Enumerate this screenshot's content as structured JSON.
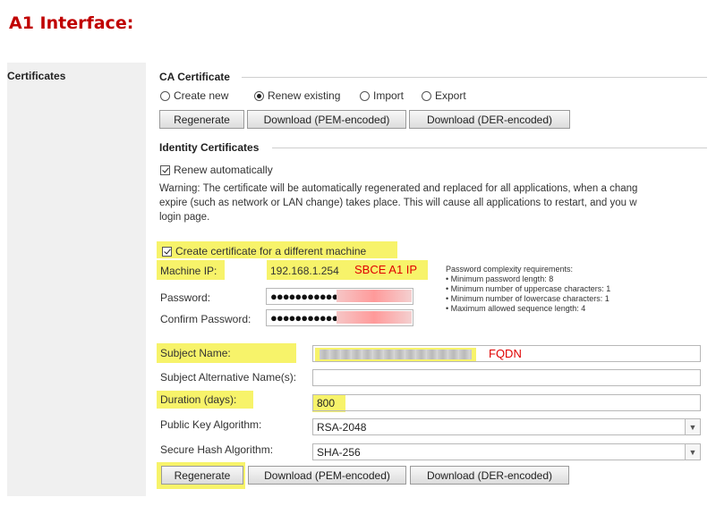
{
  "doc_title": "A1 Interface:",
  "left_panel": {
    "label": "Certificates"
  },
  "ca_certificate": {
    "title": "CA Certificate",
    "options": [
      {
        "label": "Create new",
        "selected": false
      },
      {
        "label": "Renew existing",
        "selected": true
      },
      {
        "label": "Import",
        "selected": false
      },
      {
        "label": "Export",
        "selected": false
      }
    ],
    "buttons": {
      "regenerate": "Regenerate",
      "pem": "Download (PEM-encoded)",
      "der": "Download (DER-encoded)"
    }
  },
  "identity": {
    "title": "Identity Certificates",
    "renew_auto": {
      "label": "Renew automatically",
      "checked": true
    },
    "warning": [
      "Warning: The certificate will be automatically regenerated and replaced for all applications, when a chang",
      "expire (such as network or LAN change) takes place. This will cause all applications to restart, and you w",
      "login page."
    ],
    "different_machine": {
      "label": "Create certificate for a different machine",
      "checked": true
    },
    "machine_ip": {
      "label": "Machine IP:",
      "value": "192.168.1.254",
      "annotation": "SBCE A1 IP"
    },
    "password": {
      "label": "Password:",
      "value": "●●●●●●●●●●●"
    },
    "confirm_password": {
      "label": "Confirm Password:",
      "value": "●●●●●●●●●●●"
    },
    "password_requirements": [
      "Password complexity requirements:",
      "• Minimum password length: 8",
      "• Minimum number of uppercase characters: 1",
      "• Minimum number of lowercase characters: 1",
      "• Maximum allowed sequence length: 4"
    ],
    "subject_name": {
      "label": "Subject Name:",
      "annotation": "FQDN"
    },
    "san": {
      "label": "Subject Alternative Name(s):",
      "value": ""
    },
    "duration": {
      "label": "Duration (days):",
      "value": "800"
    },
    "pk_algorithm": {
      "label": "Public Key Algorithm:",
      "value": "RSA-2048"
    },
    "hash_algorithm": {
      "label": "Secure Hash Algorithm:",
      "value": "SHA-256"
    },
    "buttons": {
      "regenerate": "Regenerate",
      "pem": "Download (PEM-encoded)",
      "der": "Download (DER-encoded)"
    }
  },
  "colors": {
    "title_red": "#c00000",
    "highlight": "#f7f36a",
    "annotation_red": "#e00000"
  }
}
